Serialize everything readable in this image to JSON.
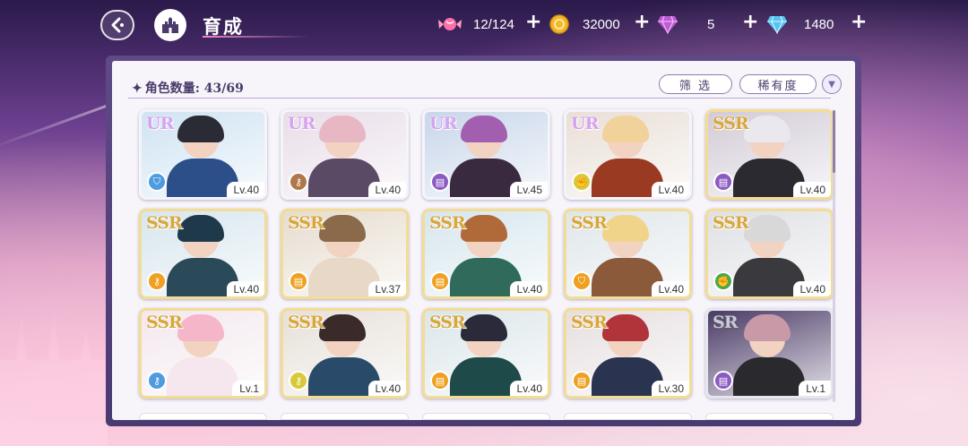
{
  "header": {
    "title": "育成",
    "resources": [
      {
        "name": "stamina",
        "icon": "candy-icon",
        "value": "12/124",
        "color": "#ff6fa8"
      },
      {
        "name": "gold",
        "icon": "coin-icon",
        "value": "32000",
        "color": "#f5b82a"
      },
      {
        "name": "pink-gem",
        "icon": "pink-diamond-icon",
        "value": "5",
        "color": "#c05ad6"
      },
      {
        "name": "blue-gem",
        "icon": "blue-diamond-icon",
        "value": "1480",
        "color": "#56c4f0"
      }
    ],
    "plus": "+"
  },
  "panel": {
    "count_label": "角色数量:",
    "count_value": "43/69",
    "filter_label": "筛 选",
    "sort_label": "稀有度",
    "dropdown_glyph": "▼"
  },
  "cards": [
    {
      "rarity": "UR",
      "level": "Lv.40",
      "element": "shield",
      "elem_color": "#4f9be0",
      "bg": "#cfe3f2",
      "hair": "#2b2b35",
      "body": "#2c4f8a",
      "art_icon": "character-portrait"
    },
    {
      "rarity": "UR",
      "level": "Lv.40",
      "element": "key",
      "elem_color": "#b0784a",
      "bg": "#e8dde8",
      "hair": "#e8b7c4",
      "body": "#5a4a66",
      "art_icon": "character-portrait"
    },
    {
      "rarity": "UR",
      "level": "Lv.45",
      "element": "book",
      "elem_color": "#8b5ac2",
      "bg": "#c8d6ea",
      "hair": "#a25fb0",
      "body": "#3a2a40",
      "art_icon": "character-portrait"
    },
    {
      "rarity": "UR",
      "level": "Lv.40",
      "element": "fist",
      "elem_color": "#d9c93a",
      "bg": "#e9dfd6",
      "hair": "#f0d29a",
      "body": "#9a3a22",
      "art_icon": "character-portrait"
    },
    {
      "rarity": "SSR",
      "level": "Lv.40",
      "element": "book",
      "elem_color": "#8b5ac2",
      "bg": "#d2cbd6",
      "hair": "#e8e8ee",
      "body": "#2a2a30",
      "art_icon": "character-portrait"
    },
    {
      "rarity": "SSR",
      "level": "Lv.40",
      "element": "key",
      "elem_color": "#f0a020",
      "bg": "#d7e6ee",
      "hair": "#1e3a4a",
      "body": "#2a4a5a",
      "art_icon": "character-portrait"
    },
    {
      "rarity": "SSR",
      "level": "Lv.37",
      "element": "book",
      "elem_color": "#f0a020",
      "bg": "#e6dccf",
      "hair": "#8a6a4a",
      "body": "#e8d8c8",
      "art_icon": "character-portrait"
    },
    {
      "rarity": "SSR",
      "level": "Lv.40",
      "element": "book",
      "elem_color": "#f0a020",
      "bg": "#d6e6ee",
      "hair": "#b06a3a",
      "body": "#2f6a5a",
      "art_icon": "character-portrait"
    },
    {
      "rarity": "SSR",
      "level": "Lv.40",
      "element": "shield",
      "elem_color": "#f0a020",
      "bg": "#dfe6ea",
      "hair": "#f0d48a",
      "body": "#8a5a3a",
      "art_icon": "character-portrait"
    },
    {
      "rarity": "SSR",
      "level": "Lv.40",
      "element": "fist",
      "elem_color": "#4aa84a",
      "bg": "#dfe0e4",
      "hair": "#d8d8d8",
      "body": "#3a3a3e",
      "art_icon": "character-portrait"
    },
    {
      "rarity": "SSR",
      "level": "Lv.1",
      "element": "key",
      "elem_color": "#4f9be0",
      "bg": "#f3e8ee",
      "hair": "#f4b6c8",
      "body": "#f6e6ee",
      "art_icon": "character-portrait"
    },
    {
      "rarity": "SSR",
      "level": "Lv.40",
      "element": "key",
      "elem_color": "#d9c93a",
      "bg": "#e6e0d8",
      "hair": "#3a2a2a",
      "body": "#2a4a6a",
      "art_icon": "character-portrait"
    },
    {
      "rarity": "SSR",
      "level": "Lv.40",
      "element": "book",
      "elem_color": "#f0a020",
      "bg": "#dbe6ea",
      "hair": "#2a2a3a",
      "body": "#1f4a4a",
      "art_icon": "character-portrait"
    },
    {
      "rarity": "SSR",
      "level": "Lv.30",
      "element": "book",
      "elem_color": "#f0a020",
      "bg": "#e6dfe0",
      "hair": "#b0343a",
      "body": "#2a3450",
      "art_icon": "character-portrait"
    },
    {
      "rarity": "SR",
      "level": "Lv.1",
      "element": "book",
      "elem_color": "#8b5ac2",
      "bg": "#4a3a66",
      "hair": "#c89aa8",
      "body": "#2a2a2e",
      "art_icon": "character-portrait"
    }
  ]
}
